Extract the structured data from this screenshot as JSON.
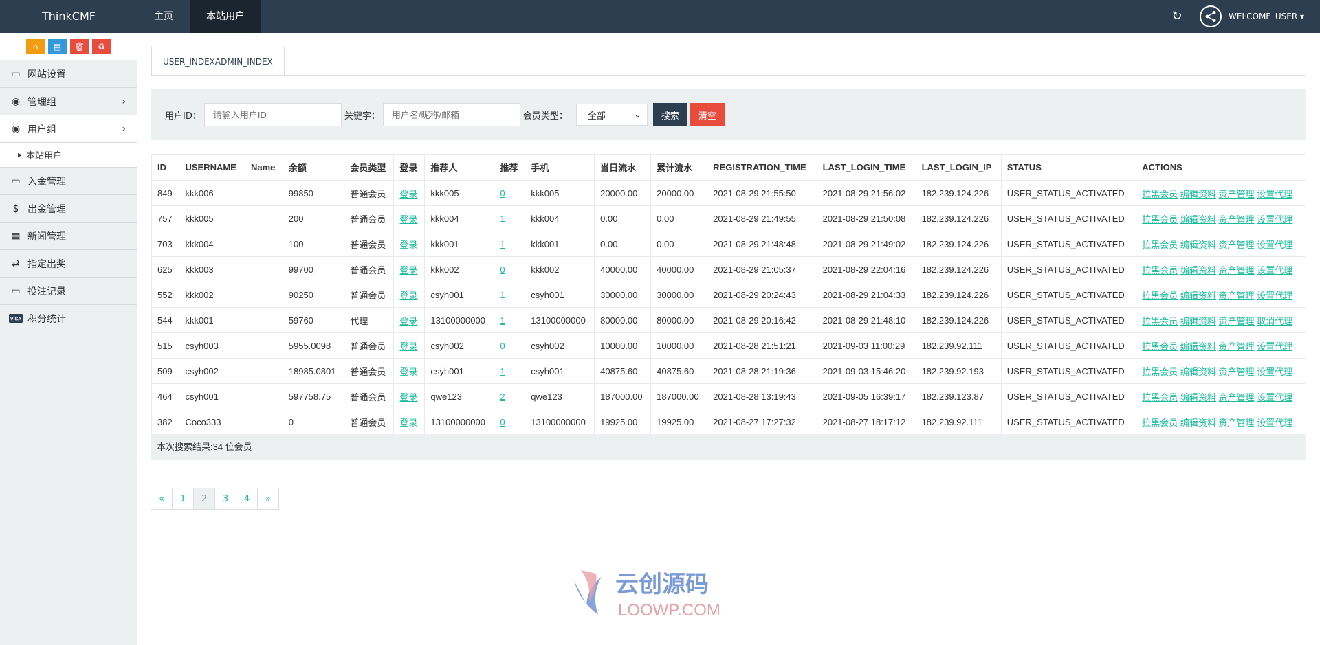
{
  "topbar": {
    "brand": "ThinkCMF",
    "nav": [
      {
        "label": "主页"
      },
      {
        "label": "本站用户"
      }
    ],
    "user": "WELCOME_USER ▾"
  },
  "sidebar": {
    "items": [
      {
        "label": "网站设置"
      },
      {
        "label": "管理组"
      },
      {
        "label": "用户组"
      },
      {
        "label": "入金管理"
      },
      {
        "label": "出金管理"
      },
      {
        "label": "新闻管理"
      },
      {
        "label": "指定出奖"
      },
      {
        "label": "投注记录"
      },
      {
        "label": "积分统计"
      }
    ],
    "sub": {
      "label": "本站用户"
    }
  },
  "tab": {
    "label": "USER_INDEXADMIN_INDEX"
  },
  "search": {
    "id_label": "用户ID：",
    "id_placeholder": "请输入用户ID",
    "kw_label": "关键字：",
    "kw_placeholder": "用户名/昵称/邮箱",
    "type_label": "会员类型：",
    "type_value": "全部",
    "search_btn": "搜索",
    "clear_btn": "清空"
  },
  "table": {
    "headers": [
      "ID",
      "USERNAME",
      "Name",
      "余额",
      "会员类型",
      "登录",
      "推荐人",
      "推荐",
      "手机",
      "当日流水",
      "累计流水",
      "REGISTRATION_TIME",
      "LAST_LOGIN_TIME",
      "LAST_LOGIN_IP",
      "STATUS",
      "ACTIONS"
    ],
    "rows": [
      {
        "id": "849",
        "username": "kkk006",
        "name": "",
        "balance": "99850",
        "type": "普通会员",
        "login": "登录",
        "referrer": "kkk005",
        "refs": "0",
        "phone": "kkk005",
        "daily": "20000.00",
        "total": "20000.00",
        "reg": "2021-08-29 21:55:50",
        "last": "2021-08-29 21:56:02",
        "ip": "182.239.124.226",
        "status": "USER_STATUS_ACTIVATED",
        "a1": "拉黑会员",
        "a2": "编辑资料",
        "a3": "资产管理",
        "a4": "设置代理"
      },
      {
        "id": "757",
        "username": "kkk005",
        "name": "",
        "balance": "200",
        "type": "普通会员",
        "login": "登录",
        "referrer": "kkk004",
        "refs": "1",
        "phone": "kkk004",
        "daily": "0.00",
        "total": "0.00",
        "reg": "2021-08-29 21:49:55",
        "last": "2021-08-29 21:50:08",
        "ip": "182.239.124.226",
        "status": "USER_STATUS_ACTIVATED",
        "a1": "拉黑会员",
        "a2": "编辑资料",
        "a3": "资产管理",
        "a4": "设置代理"
      },
      {
        "id": "703",
        "username": "kkk004",
        "name": "",
        "balance": "100",
        "type": "普通会员",
        "login": "登录",
        "referrer": "kkk001",
        "refs": "1",
        "phone": "kkk001",
        "daily": "0.00",
        "total": "0.00",
        "reg": "2021-08-29 21:48:48",
        "last": "2021-08-29 21:49:02",
        "ip": "182.239.124.226",
        "status": "USER_STATUS_ACTIVATED",
        "a1": "拉黑会员",
        "a2": "编辑资料",
        "a3": "资产管理",
        "a4": "设置代理"
      },
      {
        "id": "625",
        "username": "kkk003",
        "name": "",
        "balance": "99700",
        "type": "普通会员",
        "login": "登录",
        "referrer": "kkk002",
        "refs": "0",
        "phone": "kkk002",
        "daily": "40000.00",
        "total": "40000.00",
        "reg": "2021-08-29 21:05:37",
        "last": "2021-08-29 22:04:16",
        "ip": "182.239.124.226",
        "status": "USER_STATUS_ACTIVATED",
        "a1": "拉黑会员",
        "a2": "编辑资料",
        "a3": "资产管理",
        "a4": "设置代理"
      },
      {
        "id": "552",
        "username": "kkk002",
        "name": "",
        "balance": "90250",
        "type": "普通会员",
        "login": "登录",
        "referrer": "csyh001",
        "refs": "1",
        "phone": "csyh001",
        "daily": "30000.00",
        "total": "30000.00",
        "reg": "2021-08-29 20:24:43",
        "last": "2021-08-29 21:04:33",
        "ip": "182.239.124.226",
        "status": "USER_STATUS_ACTIVATED",
        "a1": "拉黑会员",
        "a2": "编辑资料",
        "a3": "资产管理",
        "a4": "设置代理"
      },
      {
        "id": "544",
        "username": "kkk001",
        "name": "",
        "balance": "59760",
        "type": "代理",
        "login": "登录",
        "referrer": "13100000000",
        "refs": "1",
        "phone": "13100000000",
        "daily": "80000.00",
        "total": "80000.00",
        "reg": "2021-08-29 20:16:42",
        "last": "2021-08-29 21:48:10",
        "ip": "182.239.124.226",
        "status": "USER_STATUS_ACTIVATED",
        "a1": "拉黑会员",
        "a2": "编辑资料",
        "a3": "资产管理",
        "a4": "取消代理"
      },
      {
        "id": "515",
        "username": "csyh003",
        "name": "",
        "balance": "5955.0098",
        "type": "普通会员",
        "login": "登录",
        "referrer": "csyh002",
        "refs": "0",
        "phone": "csyh002",
        "daily": "10000.00",
        "total": "10000.00",
        "reg": "2021-08-28 21:51:21",
        "last": "2021-09-03 11:00:29",
        "ip": "182.239.92.111",
        "status": "USER_STATUS_ACTIVATED",
        "a1": "拉黑会员",
        "a2": "编辑资料",
        "a3": "资产管理",
        "a4": "设置代理"
      },
      {
        "id": "509",
        "username": "csyh002",
        "name": "",
        "balance": "18985.0801",
        "type": "普通会员",
        "login": "登录",
        "referrer": "csyh001",
        "refs": "1",
        "phone": "csyh001",
        "daily": "40875.60",
        "total": "40875.60",
        "reg": "2021-08-28 21:19:36",
        "last": "2021-09-03 15:46:20",
        "ip": "182.239.92.193",
        "status": "USER_STATUS_ACTIVATED",
        "a1": "拉黑会员",
        "a2": "编辑资料",
        "a3": "资产管理",
        "a4": "设置代理"
      },
      {
        "id": "464",
        "username": "csyh001",
        "name": "",
        "balance": "597758.75",
        "type": "普通会员",
        "login": "登录",
        "referrer": "qwe123",
        "refs": "2",
        "phone": "qwe123",
        "daily": "187000.00",
        "total": "187000.00",
        "reg": "2021-08-28 13:19:43",
        "last": "2021-09-05 16:39:17",
        "ip": "182.239.123.87",
        "status": "USER_STATUS_ACTIVATED",
        "a1": "拉黑会员",
        "a2": "编辑资料",
        "a3": "资产管理",
        "a4": "设置代理"
      },
      {
        "id": "382",
        "username": "Coco333",
        "name": "",
        "balance": "0",
        "type": "普通会员",
        "login": "登录",
        "referrer": "13100000000",
        "refs": "0",
        "phone": "13100000000",
        "daily": "19925.00",
        "total": "19925.00",
        "reg": "2021-08-27 17:27:32",
        "last": "2021-08-27 18:17:12",
        "ip": "182.239.92.111",
        "status": "USER_STATUS_ACTIVATED",
        "a1": "拉黑会员",
        "a2": "编辑资料",
        "a3": "资产管理",
        "a4": "设置代理"
      }
    ],
    "footer": "本次搜索结果:34 位会员"
  },
  "pager": [
    "«",
    "1",
    "2",
    "3",
    "4",
    "»"
  ],
  "watermark": {
    "line1": "云创源码",
    "line2": "LOOWP.COM"
  }
}
